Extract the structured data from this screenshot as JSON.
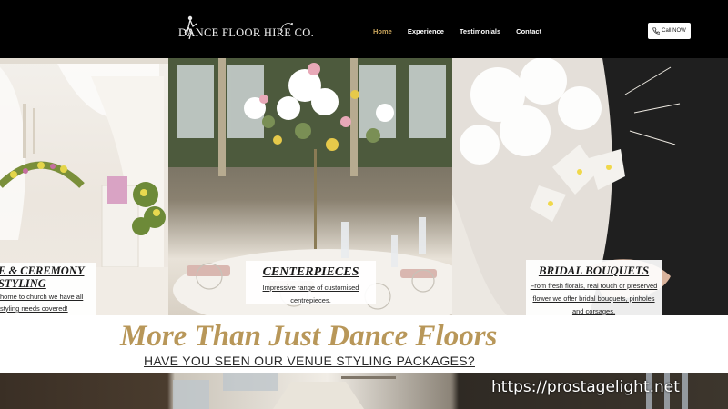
{
  "header": {
    "logo_text": "DANCE FLOOR HIRE CO.",
    "nav": [
      {
        "label": "Home",
        "active": true
      },
      {
        "label": "Experience",
        "active": false
      },
      {
        "label": "Testimonials",
        "active": false
      },
      {
        "label": "Contact",
        "active": false
      }
    ],
    "call_label": "Call NOW"
  },
  "panels": [
    {
      "title_lines": [
        "E & CEREMONY",
        "STYLING"
      ],
      "body_lines": [
        "home to church we have all",
        "styling needs covered!"
      ]
    },
    {
      "title_lines": [
        "CENTERPIECES"
      ],
      "body_lines": [
        "Impressive range of customised",
        "centrepieces."
      ]
    },
    {
      "title_lines": [
        "BRIDAL BOUQUETS"
      ],
      "body_lines": [
        "From fresh florals, real touch or preserved",
        "flower we offer bridal bouquets, pinholes",
        "and corsages."
      ]
    }
  ],
  "section": {
    "headline": "More Than Just Dance Floors",
    "subline": "HAVE YOU SEEN OUR VENUE STYLING PACKAGES?"
  },
  "watermark": "https://prostagelight.net",
  "colors": {
    "header_bg": "#000000",
    "nav_active": "#c9a45c",
    "headline_gold": "#b89759"
  },
  "icons": {
    "logo": "dancer-silhouette-icon",
    "call": "phone-icon"
  }
}
